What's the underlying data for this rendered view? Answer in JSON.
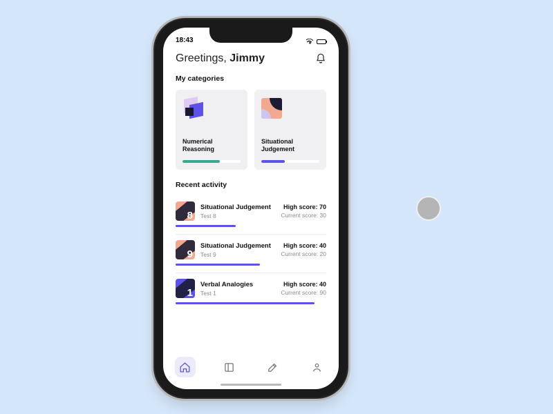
{
  "status": {
    "time": "18:43"
  },
  "header": {
    "greeting_prefix": "Greetings, ",
    "name": "Jimmy"
  },
  "sections": {
    "categories": "My categories",
    "activity": "Recent activity"
  },
  "categories": [
    {
      "label": "Numerical Reasoning",
      "progress": 64,
      "bar_color": "#3aa88f"
    },
    {
      "label": "Situational Judgement",
      "progress": 40,
      "bar_color": "#5c52e8"
    }
  ],
  "activity": [
    {
      "badge": "8",
      "title": "Situational Judgement",
      "subtitle": "Test 8",
      "high_label": "High score: ",
      "high": 70,
      "current_label": "Current score: ",
      "current": 30,
      "bar_pct": 40
    },
    {
      "badge": "9",
      "title": "Situational Judgement",
      "subtitle": "Test 9",
      "high_label": "High score: ",
      "high": 40,
      "current_label": "Current score: ",
      "current": 20,
      "bar_pct": 56
    },
    {
      "badge": "1",
      "title": "Verbal Analogies",
      "subtitle": "Test 1",
      "high_label": "High score: ",
      "high": 40,
      "current_label": "Current score: ",
      "current": 90,
      "bar_pct": 92
    }
  ],
  "tabs": [
    "home",
    "library",
    "compose",
    "profile"
  ]
}
